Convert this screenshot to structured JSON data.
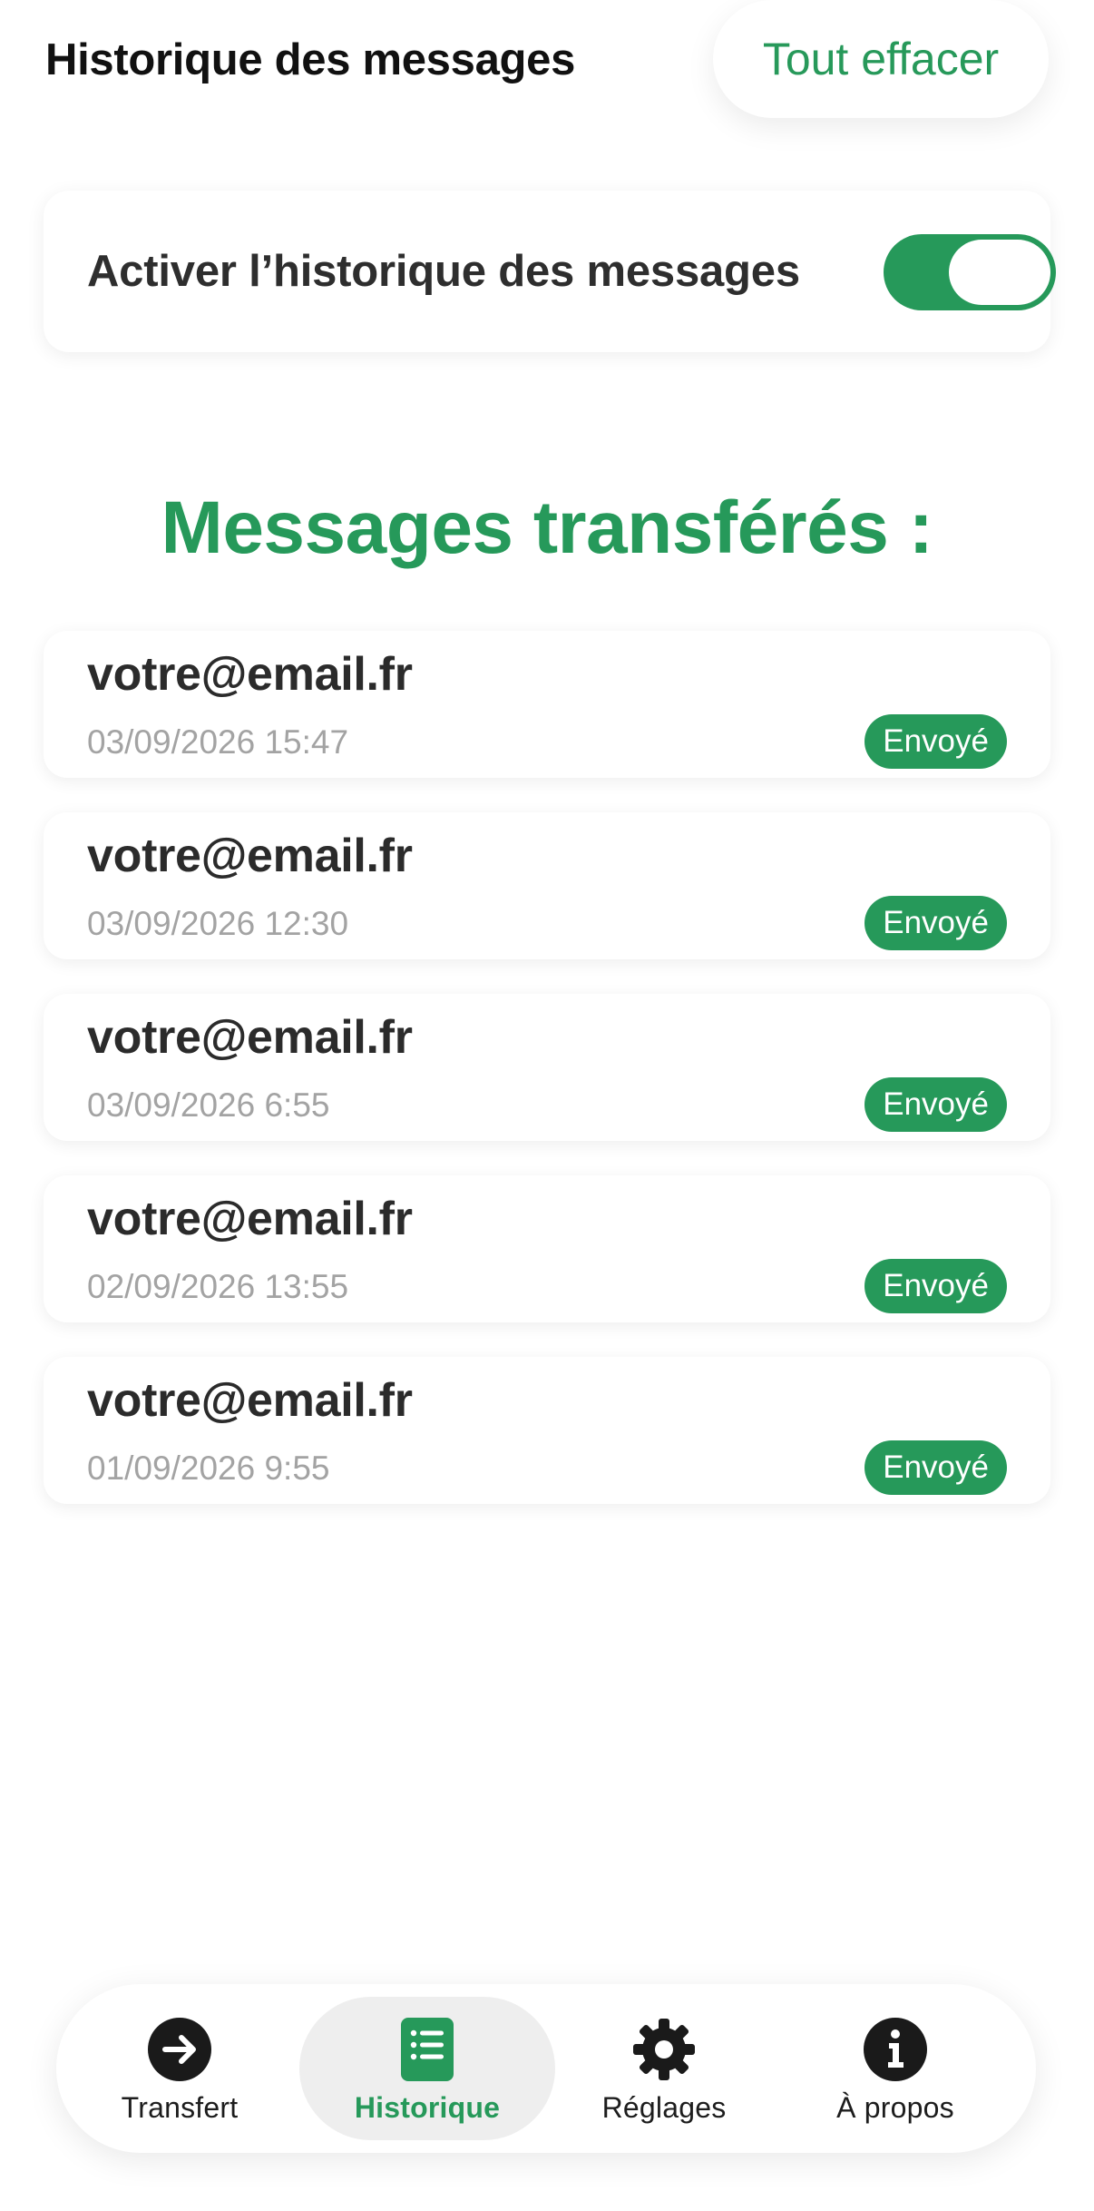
{
  "header": {
    "title": "Historique des messages",
    "clear_all_label": "Tout effacer"
  },
  "history_toggle": {
    "label": "Activer l’historique des messages",
    "enabled": true
  },
  "section": {
    "title": "Messages transférés :"
  },
  "messages": [
    {
      "email": "votre@email.fr",
      "date": "03/09/2026 15:47",
      "status": "Envoyé"
    },
    {
      "email": "votre@email.fr",
      "date": "03/09/2026 12:30",
      "status": "Envoyé"
    },
    {
      "email": "votre@email.fr",
      "date": "03/09/2026 6:55",
      "status": "Envoyé"
    },
    {
      "email": "votre@email.fr",
      "date": "02/09/2026 13:55",
      "status": "Envoyé"
    },
    {
      "email": "votre@email.fr",
      "date": "01/09/2026 9:55",
      "status": "Envoyé"
    }
  ],
  "nav": {
    "active": "history",
    "items": [
      {
        "id": "transfer",
        "label": "Transfert",
        "icon": "arrow-right-circle-icon"
      },
      {
        "id": "history",
        "label": "Historique",
        "icon": "list-document-icon"
      },
      {
        "id": "settings",
        "label": "Réglages",
        "icon": "gear-icon"
      },
      {
        "id": "about",
        "label": "À propos",
        "icon": "info-circle-icon"
      }
    ]
  },
  "colors": {
    "accent": "#26995a",
    "text": "#2b2b2b",
    "muted": "#a3a3a3",
    "nav_active_bg": "#eeeeee"
  }
}
